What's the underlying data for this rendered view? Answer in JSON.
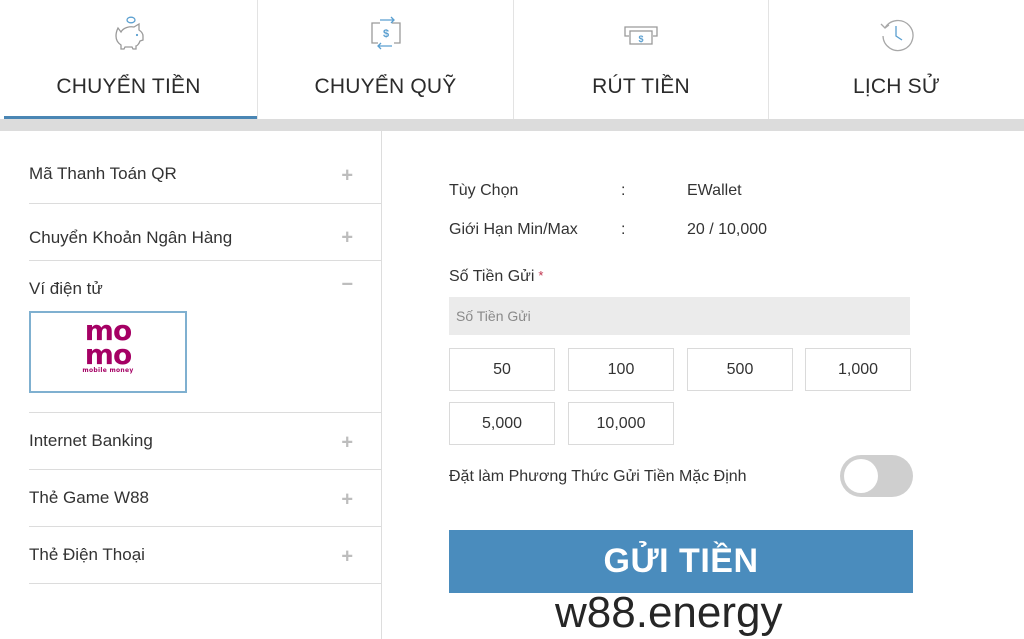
{
  "tabs": [
    {
      "label": "CHUYỂN TIỀN",
      "icon": "piggy-bank-icon",
      "active": true
    },
    {
      "label": "CHUYỂN QUỸ",
      "icon": "transfer-dollar-icon",
      "active": false
    },
    {
      "label": "RÚT TIỀN",
      "icon": "cash-withdraw-icon",
      "active": false
    },
    {
      "label": "LỊCH SỬ",
      "icon": "history-clock-icon",
      "active": false
    }
  ],
  "sidebar": {
    "items": [
      {
        "label": "Mã Thanh Toán QR",
        "toggle": "+"
      },
      {
        "label": "Chuyển Khoản Ngân Hàng",
        "toggle": "+"
      },
      {
        "label": "Ví điện tử",
        "toggle": "−",
        "expanded": true,
        "option": {
          "logo_top": "mo",
          "logo_bottom": "mo",
          "logo_sub": "mobile money"
        }
      },
      {
        "label": "Internet Banking",
        "toggle": "+"
      },
      {
        "label": "Thẻ Game W88",
        "toggle": "+"
      },
      {
        "label": "Thẻ Điện Thoại",
        "toggle": "+"
      }
    ]
  },
  "form": {
    "option_label": "Tùy Chọn",
    "option_value": "EWallet",
    "limit_label": "Giới Hạn Min/Max",
    "limit_value": "20 / 10,000",
    "colon": ":",
    "amount_label": "Số Tiền Gửi",
    "required_mark": "*",
    "amount_placeholder": "Số Tiền Gửi",
    "amount_value": "",
    "quick_amounts": [
      "50",
      "100",
      "500",
      "1,000",
      "5,000",
      "10,000"
    ],
    "default_method_label": "Đặt làm Phương Thức Gửi Tiền Mặc Định",
    "default_method_on": false,
    "submit_label": "GỬI TIỀN"
  },
  "colors": {
    "accent": "#4a8cbd",
    "momo": "#a50064",
    "required": "#c0334d"
  },
  "watermark": "w88.energy"
}
